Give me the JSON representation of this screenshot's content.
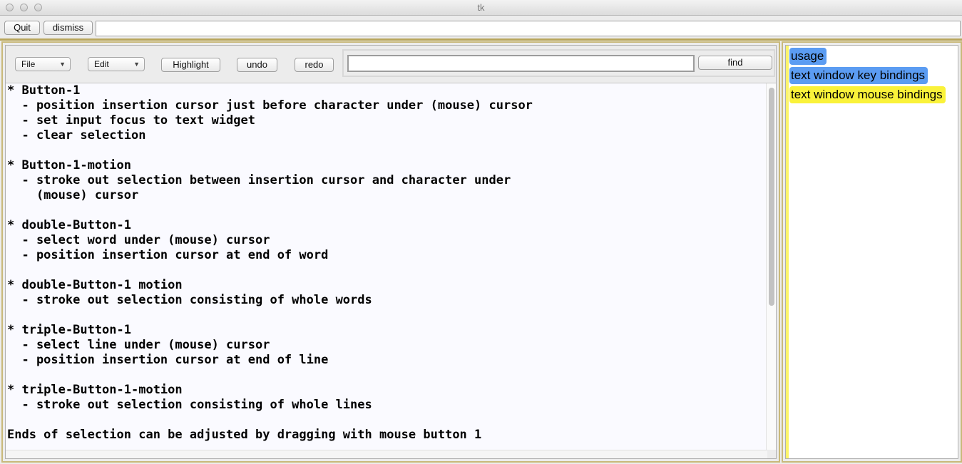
{
  "window": {
    "title": "tk"
  },
  "topbar": {
    "quit_label": "Quit",
    "dismiss_label": "dismiss",
    "entry_value": ""
  },
  "toolbar": {
    "file_menu_label": "File",
    "edit_menu_label": "Edit",
    "highlight_label": "Highlight",
    "undo_label": "undo",
    "redo_label": "redo",
    "find_entry_value": "",
    "find_label": "find"
  },
  "text_window": {
    "content": "* Button-1\n  - position insertion cursor just before character under (mouse) cursor\n  - set input focus to text widget\n  - clear selection\n\n* Button-1-motion\n  - stroke out selection between insertion cursor and character under\n    (mouse) cursor\n\n* double-Button-1\n  - select word under (mouse) cursor\n  - position insertion cursor at end of word\n\n* double-Button-1 motion\n  - stroke out selection consisting of whole words\n\n* triple-Button-1\n  - select line under (mouse) cursor\n  - position insertion cursor at end of line\n\n* triple-Button-1-motion\n  - stroke out selection consisting of whole lines\n\nEnds of selection can be adjusted by dragging with mouse button 1"
  },
  "topics": {
    "items": [
      {
        "label": "usage",
        "highlight": "#5b9cf2"
      },
      {
        "label": "text window key bindings",
        "highlight": "#5b9cf2"
      },
      {
        "label": "text window mouse bindings",
        "highlight": "#faf23a"
      }
    ]
  },
  "colors": {
    "accent_border": "#c9b97a",
    "text_background": "#fafaff"
  }
}
